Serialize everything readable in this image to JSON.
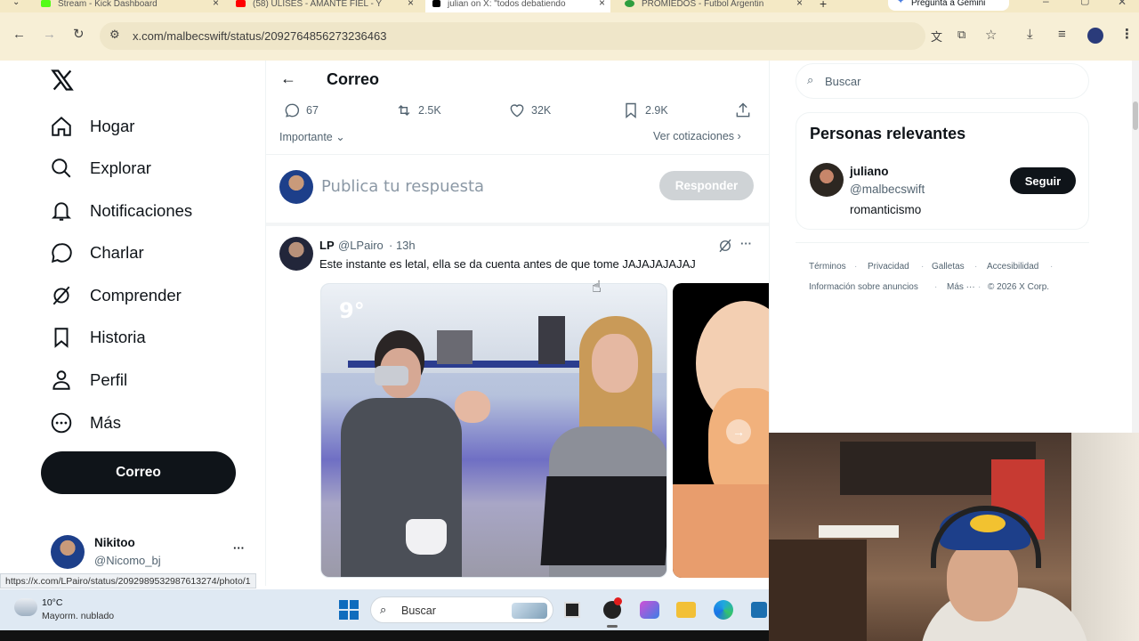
{
  "browser": {
    "tabs": [
      {
        "title": "Stream - Kick Dashboard",
        "favicon_color": "#53fc18"
      },
      {
        "title": "(58) ULISES - AMANTE FIEL - Y",
        "favicon_color": "#ff0000"
      },
      {
        "title": "julian on X: \"todos debatiendo",
        "favicon_color": "#000000"
      },
      {
        "title": "PROMIEDOS - Futbol Argentin",
        "favicon_color": "#2e9e3e"
      }
    ],
    "new_tab": "+",
    "gemini_button": "Pregunta a Gemini",
    "url": "x.com/malbecswift/status/2092764856273236463"
  },
  "x": {
    "nav": [
      {
        "label": "Hogar",
        "icon": "home-icon"
      },
      {
        "label": "Explorar",
        "icon": "search-icon"
      },
      {
        "label": "Notificaciones",
        "icon": "bell-icon"
      },
      {
        "label": "Charlar",
        "icon": "chat-icon"
      },
      {
        "label": "Comprender",
        "icon": "grok-icon"
      },
      {
        "label": "Historia",
        "icon": "bookmark-icon"
      },
      {
        "label": "Perfil",
        "icon": "person-icon"
      },
      {
        "label": "Más",
        "icon": "more-circle-icon"
      }
    ],
    "post_button": "Correo",
    "account": {
      "name": "Nikitoo",
      "handle": "@Nicomo_bj",
      "more": "···"
    },
    "header_title": "Correo",
    "stats": {
      "replies": "67",
      "reposts": "2.5K",
      "likes": "32K",
      "bookmarks": "2.9K"
    },
    "importante": "Importante",
    "ver_cotizaciones": "Ver cotizaciones",
    "reply_placeholder": "Publica tu respuesta",
    "reply_button": "Responder",
    "reply_post": {
      "name": "LP",
      "handle": "@LPairo",
      "time": "· 13h",
      "text": "Este instante es letal, ella se da cuenta antes de que tome JAJAJAJAJAJ",
      "media_badge": "9°"
    },
    "search_placeholder": "Buscar",
    "relevant_title": "Personas relevantes",
    "relevant_person": {
      "name": "juliano",
      "handle": "@malbecswift",
      "bio": "romanticismo",
      "follow": "Seguir"
    },
    "footer_links": [
      "Términos",
      "Privacidad",
      "Galletas",
      "Accesibilidad",
      "Información sobre anuncios",
      "Más ···",
      "© 2026 X Corp."
    ]
  },
  "status_url": "https://x.com/LPairo/status/2092989532987613274/photo/1",
  "taskbar": {
    "weather_temp": "10°C",
    "weather_desc": "Mayorm. nublado",
    "search": "Buscar"
  }
}
